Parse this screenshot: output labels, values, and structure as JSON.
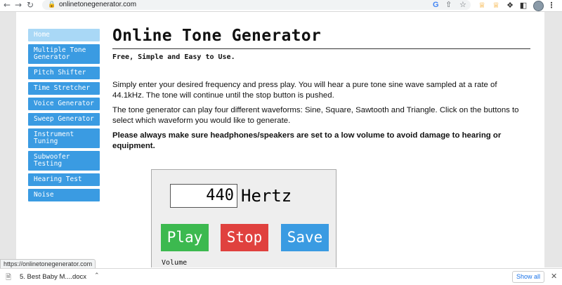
{
  "browser": {
    "url": "onlinetonegenerator.com",
    "back_icon": "arrow-left-icon",
    "forward_icon": "arrow-right-icon",
    "reload_icon": "reload-icon"
  },
  "sidebar": {
    "items": [
      {
        "label": "Home"
      },
      {
        "label": "Multiple Tone Generator"
      },
      {
        "label": "Pitch Shifter"
      },
      {
        "label": "Time Stretcher"
      },
      {
        "label": "Voice Generator"
      },
      {
        "label": "Sweep Generator"
      },
      {
        "label": "Instrument Tuning"
      },
      {
        "label": "Subwoofer Testing"
      },
      {
        "label": "Hearing Test"
      },
      {
        "label": "Noise"
      }
    ]
  },
  "main": {
    "title": "Online Tone Generator",
    "subtitle": "Free, Simple and Easy to Use.",
    "paragraph1": "Simply enter your desired frequency and press play. You will hear a pure tone sine wave sampled at a rate of 44.1kHz. The tone will continue until the stop button is pushed.",
    "paragraph2": "The tone generator can play four different waveforms: Sine, Square, Sawtooth and Triangle. Click on the buttons to select which waveform you would like to generate.",
    "warning": "Please always make sure headphones/speakers are set to a low volume to avoid damage to hearing or equipment."
  },
  "generator": {
    "frequency": "440",
    "unit": "Hertz",
    "play_label": "Play",
    "stop_label": "Stop",
    "save_label": "Save",
    "volume_label": "Volume"
  },
  "status_bar": {
    "link_url": "https://onlinetonegenerator.com"
  },
  "download_bar": {
    "file_name": "5. Best Baby M....docx",
    "show_all_label": "Show all"
  },
  "colors": {
    "button_blue": "#3a9be2",
    "active_blue": "#a9d8f6",
    "play_green": "#3cb94f",
    "stop_red": "#e0413e"
  }
}
